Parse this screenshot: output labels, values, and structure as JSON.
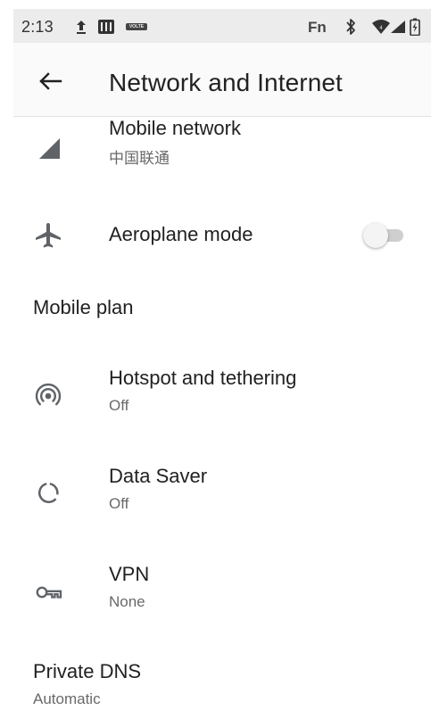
{
  "status_bar": {
    "time": "2:13",
    "fn_label": "Fn",
    "volte_label": "VOLTE",
    "icons": [
      "upload-icon",
      "sim-card-icon",
      "volte-icon",
      "bluetooth-icon",
      "wifi-icon",
      "signal-icon",
      "battery-charging-icon"
    ]
  },
  "header": {
    "title": "Network and Internet",
    "back_icon": "arrow-back-icon"
  },
  "settings": {
    "mobile_network": {
      "title": "Mobile network",
      "subtitle": "中国联通",
      "icon": "cellular-signal-icon"
    },
    "aeroplane_mode": {
      "title": "Aeroplane mode",
      "icon": "airplane-icon",
      "enabled": false
    },
    "mobile_plan": {
      "title": "Mobile plan"
    },
    "hotspot": {
      "title": "Hotspot and tethering",
      "subtitle": "Off",
      "icon": "hotspot-icon"
    },
    "data_saver": {
      "title": "Data Saver",
      "subtitle": "Off",
      "icon": "data-saver-icon"
    },
    "vpn": {
      "title": "VPN",
      "subtitle": "None",
      "icon": "vpn-key-icon"
    },
    "private_dns": {
      "title": "Private DNS",
      "subtitle": "Automatic"
    }
  },
  "colors": {
    "status_bar": "#ececec",
    "app_bar": "#fafafa",
    "primary_text": "#212121",
    "secondary_text": "#696969",
    "icon": "#5f6368",
    "switch_track": "#cfcfcf",
    "switch_thumb": "#f4f4f4"
  }
}
